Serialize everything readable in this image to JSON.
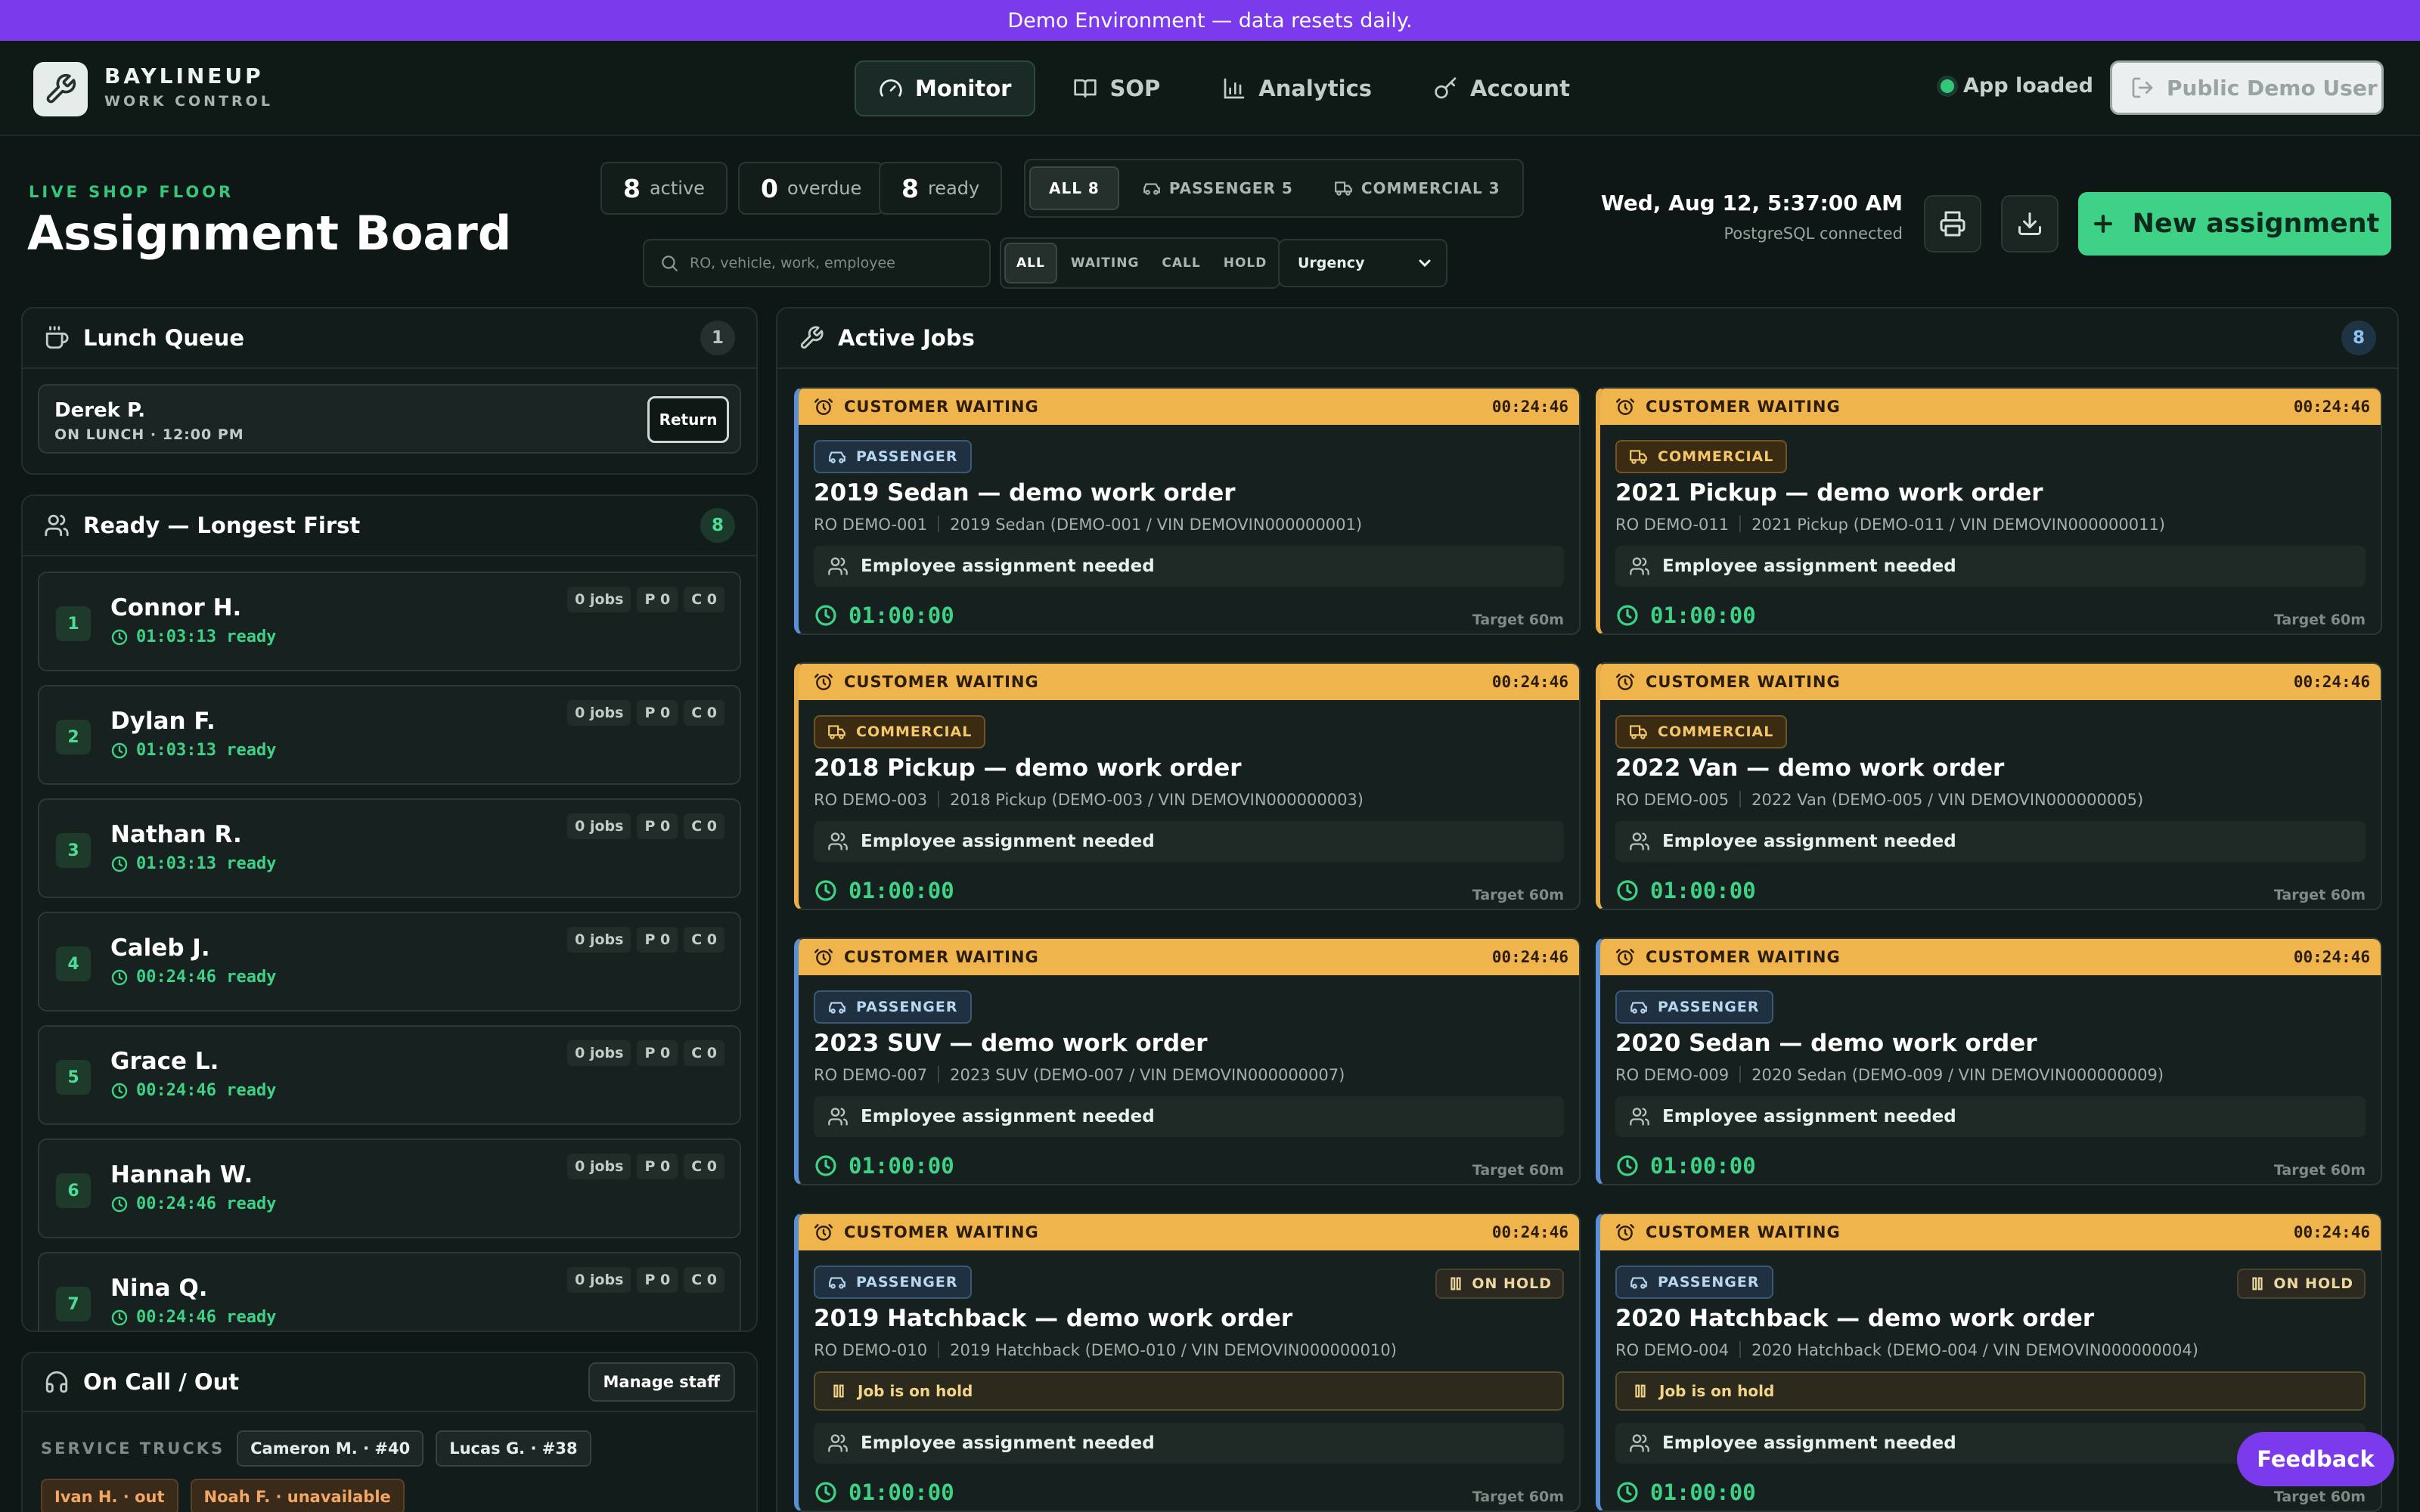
{
  "banner": {
    "text": "Demo Environment — data resets daily."
  },
  "brand": {
    "name": "BAYLINEUP",
    "subtitle": "WORK CONTROL",
    "icon": "wrench-icon"
  },
  "nav": {
    "items": [
      {
        "label": "Monitor",
        "icon": "gauge-icon",
        "active": true
      },
      {
        "label": "SOP",
        "icon": "book-icon"
      },
      {
        "label": "Analytics",
        "icon": "bar-chart-icon"
      },
      {
        "label": "Account",
        "icon": "key-icon"
      }
    ],
    "status": "App loaded",
    "user_button": "Public Demo User"
  },
  "header": {
    "subtitle": "LIVE SHOP FLOOR",
    "title": "Assignment Board",
    "stats": [
      {
        "value": "8",
        "label": "active"
      },
      {
        "value": "0",
        "label": "overdue"
      },
      {
        "value": "8",
        "label": "ready"
      }
    ],
    "type_filter": {
      "all": "ALL 8",
      "passenger": "PASSENGER 5",
      "commercial": "COMMERCIAL 3"
    },
    "search_placeholder": "RO, vehicle, work, employee",
    "status_filter": [
      "ALL",
      "WAITING",
      "CALL",
      "HOLD"
    ],
    "sort_value": "Urgency",
    "datetime": "Wed, Aug 12, 5:37:00 AM",
    "db_status": "PostgreSQL connected",
    "new_button": "New assignment"
  },
  "lunch": {
    "title": "Lunch Queue",
    "count": "1",
    "items": [
      {
        "name": "Derek P.",
        "status": "ON LUNCH · 12:00 PM",
        "action": "Return"
      }
    ]
  },
  "ready": {
    "title": "Ready — Longest First",
    "count": "8",
    "items": [
      {
        "rank": "1",
        "name": "Connor H.",
        "time": "01:03:13 ready",
        "jobs": "0 jobs",
        "p": "P 0",
        "c": "C 0"
      },
      {
        "rank": "2",
        "name": "Dylan F.",
        "time": "01:03:13 ready",
        "jobs": "0 jobs",
        "p": "P 0",
        "c": "C 0"
      },
      {
        "rank": "3",
        "name": "Nathan R.",
        "time": "01:03:13 ready",
        "jobs": "0 jobs",
        "p": "P 0",
        "c": "C 0"
      },
      {
        "rank": "4",
        "name": "Caleb J.",
        "time": "00:24:46 ready",
        "jobs": "0 jobs",
        "p": "P 0",
        "c": "C 0"
      },
      {
        "rank": "5",
        "name": "Grace L.",
        "time": "00:24:46 ready",
        "jobs": "0 jobs",
        "p": "P 0",
        "c": "C 0"
      },
      {
        "rank": "6",
        "name": "Hannah W.",
        "time": "00:24:46 ready",
        "jobs": "0 jobs",
        "p": "P 0",
        "c": "C 0"
      },
      {
        "rank": "7",
        "name": "Nina Q.",
        "time": "00:24:46 ready",
        "jobs": "0 jobs",
        "p": "P 0",
        "c": "C 0"
      }
    ]
  },
  "oncall": {
    "title": "On Call / Out",
    "manage_button": "Manage staff",
    "trucks_label": "SERVICE TRUCKS",
    "chips": [
      {
        "text": "Cameron M. · #40",
        "warn": false
      },
      {
        "text": "Lucas G. · #38",
        "warn": false
      },
      {
        "text": "Ivan H. · out",
        "warn": true
      },
      {
        "text": "Noah F. · unavailable",
        "warn": true
      }
    ]
  },
  "jobs": {
    "title": "Active Jobs",
    "count": "8",
    "status_label": "CUSTOMER WAITING",
    "timer": "00:24:46",
    "assign_text": "Employee assignment needed",
    "hold_text": "Job is on hold",
    "hold_badge": "ON HOLD",
    "elapsed": "01:00:00",
    "target": "Target 60m",
    "items": [
      {
        "type": "PASSENGER",
        "title": "2019 Sedan — demo work order",
        "ro": "RO DEMO-001",
        "vehicle": "2019 Sedan (DEMO-001 / VIN DEMOVIN000000001)",
        "hold": false
      },
      {
        "type": "COMMERCIAL",
        "title": "2021 Pickup — demo work order",
        "ro": "RO DEMO-011",
        "vehicle": "2021 Pickup (DEMO-011 / VIN DEMOVIN000000011)",
        "hold": false
      },
      {
        "type": "COMMERCIAL",
        "title": "2018 Pickup — demo work order",
        "ro": "RO DEMO-003",
        "vehicle": "2018 Pickup (DEMO-003 / VIN DEMOVIN000000003)",
        "hold": false
      },
      {
        "type": "COMMERCIAL",
        "title": "2022 Van — demo work order",
        "ro": "RO DEMO-005",
        "vehicle": "2022 Van (DEMO-005 / VIN DEMOVIN000000005)",
        "hold": false
      },
      {
        "type": "PASSENGER",
        "title": "2023 SUV — demo work order",
        "ro": "RO DEMO-007",
        "vehicle": "2023 SUV (DEMO-007 / VIN DEMOVIN000000007)",
        "hold": false
      },
      {
        "type": "PASSENGER",
        "title": "2020 Sedan — demo work order",
        "ro": "RO DEMO-009",
        "vehicle": "2020 Sedan (DEMO-009 / VIN DEMOVIN000000009)",
        "hold": false
      },
      {
        "type": "PASSENGER",
        "title": "2019 Hatchback — demo work order",
        "ro": "RO DEMO-010",
        "vehicle": "2019 Hatchback (DEMO-010 / VIN DEMOVIN000000010)",
        "hold": true
      },
      {
        "type": "PASSENGER",
        "title": "2020 Hatchback — demo work order",
        "ro": "RO DEMO-004",
        "vehicle": "2020 Hatchback (DEMO-004 / VIN DEMOVIN000000004)",
        "hold": true
      }
    ]
  },
  "feedback_button": "Feedback",
  "colors": {
    "accent": "#7c3aed",
    "primary": "#3ed286",
    "waiting": "#f0b44c",
    "passenger": "#5b8fd6",
    "commercial": "#e9ae49"
  }
}
